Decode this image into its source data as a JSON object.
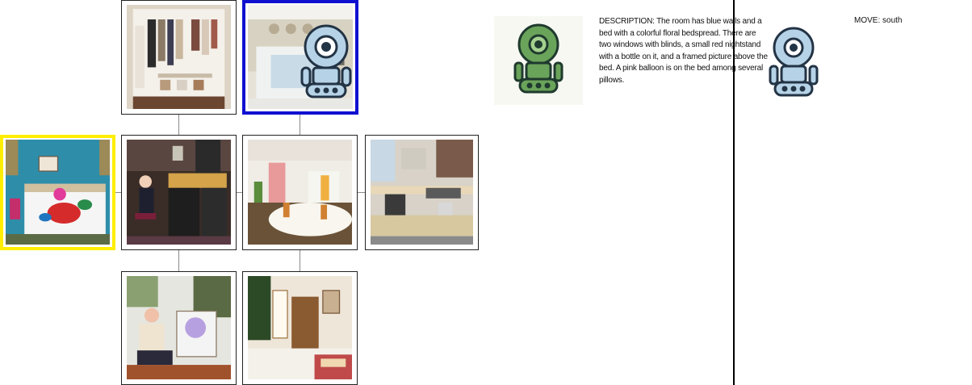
{
  "description": {
    "text": "DESCRIPTION: The room has blue walls and a bed with a colorful floral bedspread. There are two windows with blinds, a small red nightstand with a bottle on it, and a framed picture above the bed. A pink balloon is on the bed among several pillows."
  },
  "action": {
    "text": "MOVE: south"
  },
  "colors": {
    "explorer_frame": "#1010d0",
    "target_frame": "#ffee00",
    "agent_robot": "#6aa35a",
    "helper_robot": "#b6d2e6"
  },
  "icons": {
    "agent": "robot-icon",
    "helper": "robot-icon"
  }
}
